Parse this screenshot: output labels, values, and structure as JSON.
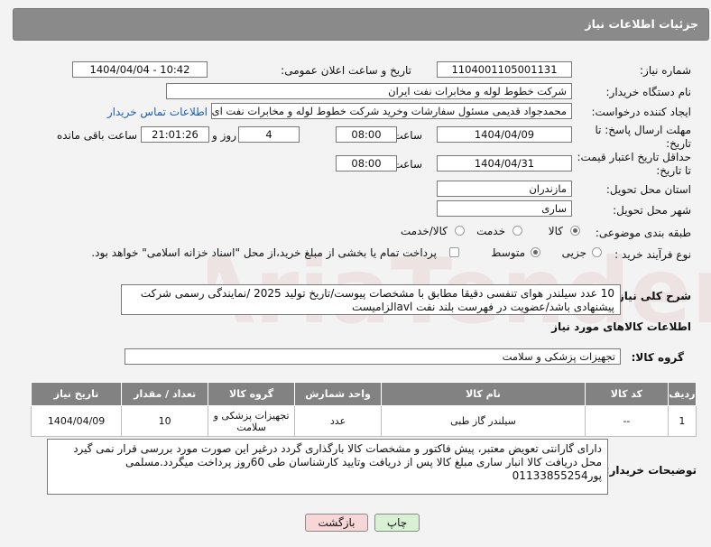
{
  "header": {
    "title": "جزئیات اطلاعات نیاز"
  },
  "form": {
    "need_number_label": "شماره نیاز:",
    "need_number": "1104001105001131",
    "announce_label": "تاریخ و ساعت اعلان عمومی:",
    "announce_value": "1404/04/04 - 10:42",
    "buyer_org_label": "نام دستگاه خریدار:",
    "buyer_org": "شرکت خطوط لوله و مخابرات نفت ایران",
    "creator_label": "ایجاد کننده درخواست:",
    "creator": "محمدجواد قدیمی مسئول سفارشات وخرید شرکت خطوط لوله و مخابرات نفت ای",
    "contact_link": "اطلاعات تماس خریدار",
    "deadline_label": "مهلت ارسال پاسخ: تا تاریخ:",
    "deadline_date": "1404/04/09",
    "time_label": "ساعت",
    "deadline_time": "08:00",
    "days_value": "4",
    "days_label": "روز و",
    "remaining_time": "21:01:26",
    "remaining_label": "ساعت باقی مانده",
    "validity_label": "حداقل تاریخ اعتبار قیمت: تا تاریخ:",
    "validity_date": "1404/04/31",
    "validity_time": "08:00",
    "province_label": "استان محل تحویل:",
    "province": "مازندران",
    "city_label": "شهر محل تحویل:",
    "city": "ساری",
    "category_label": "طبقه بندی موضوعی:",
    "category_options": [
      "کالا",
      "خدمت",
      "کالا/خدمت"
    ],
    "process_label": "نوع فرآیند خرید :",
    "process_options": [
      "جزیی",
      "متوسط"
    ],
    "process_note": "پرداخت تمام یا بخشی از مبلغ خرید،از محل \"اسناد خزانه اسلامی\" خواهد بود."
  },
  "description": {
    "label": "شرح کلی نیاز:",
    "text": "10 عدد سیلندر هوای تنفسی دقیقا مطابق با مشخصات پیوست/تاریخ تولید 2025 /نمایندگی رسمی شرکت پیشنهادی باشد/عضویت در فهرست بلند نفت avlالزامیست"
  },
  "goods_section": {
    "title": "اطلاعات کالاهای مورد نیاز",
    "group_label": "گروه کالا:",
    "group_value": "تجهیزات پزشکی و سلامت"
  },
  "table": {
    "headers": [
      "ردیف",
      "کد کالا",
      "نام کالا",
      "واحد شمارش",
      "گروه کالا",
      "تعداد / مقدار",
      "تاریخ نیاز"
    ],
    "rows": [
      [
        "1",
        "--",
        "سیلندر گاز طبی",
        "عدد",
        "تجهیزات پزشکی و سلامت",
        "10",
        "1404/04/09"
      ]
    ]
  },
  "buyer_notes": {
    "label": "توضیحات خریدار:",
    "text": "دارای گارانتی تعویض معتبر، پیش فاکتور و مشخصات کالا بارگذاری گردد درغیر این صورت مورد بررسی قرار نمی گیرد محل دریافت کالا انبار ساری  مبلغ کالا پس از دریافت وتایید کارشناسان طی 60روز پرداخت میگردد.مسلمی پور01133855254"
  },
  "buttons": {
    "print": "چاپ",
    "back": "بازگشت"
  },
  "colors": {
    "header_bg": "#8a8a8a",
    "link": "#1a5fb4",
    "back_btn": "#f6d6d6",
    "print_btn": "#d8f1d2"
  }
}
